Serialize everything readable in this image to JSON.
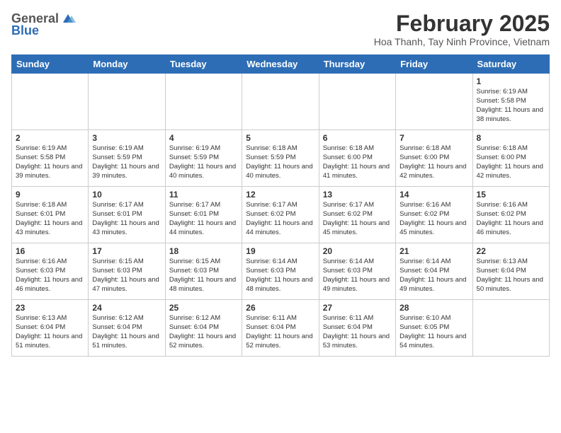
{
  "header": {
    "logo_general": "General",
    "logo_blue": "Blue",
    "month_title": "February 2025",
    "location": "Hoa Thanh, Tay Ninh Province, Vietnam"
  },
  "weekdays": [
    "Sunday",
    "Monday",
    "Tuesday",
    "Wednesday",
    "Thursday",
    "Friday",
    "Saturday"
  ],
  "weeks": [
    [
      {
        "day": "",
        "info": ""
      },
      {
        "day": "",
        "info": ""
      },
      {
        "day": "",
        "info": ""
      },
      {
        "day": "",
        "info": ""
      },
      {
        "day": "",
        "info": ""
      },
      {
        "day": "",
        "info": ""
      },
      {
        "day": "1",
        "info": "Sunrise: 6:19 AM\nSunset: 5:58 PM\nDaylight: 11 hours and 38 minutes."
      }
    ],
    [
      {
        "day": "2",
        "info": "Sunrise: 6:19 AM\nSunset: 5:58 PM\nDaylight: 11 hours and 39 minutes."
      },
      {
        "day": "3",
        "info": "Sunrise: 6:19 AM\nSunset: 5:59 PM\nDaylight: 11 hours and 39 minutes."
      },
      {
        "day": "4",
        "info": "Sunrise: 6:19 AM\nSunset: 5:59 PM\nDaylight: 11 hours and 40 minutes."
      },
      {
        "day": "5",
        "info": "Sunrise: 6:18 AM\nSunset: 5:59 PM\nDaylight: 11 hours and 40 minutes."
      },
      {
        "day": "6",
        "info": "Sunrise: 6:18 AM\nSunset: 6:00 PM\nDaylight: 11 hours and 41 minutes."
      },
      {
        "day": "7",
        "info": "Sunrise: 6:18 AM\nSunset: 6:00 PM\nDaylight: 11 hours and 42 minutes."
      },
      {
        "day": "8",
        "info": "Sunrise: 6:18 AM\nSunset: 6:00 PM\nDaylight: 11 hours and 42 minutes."
      }
    ],
    [
      {
        "day": "9",
        "info": "Sunrise: 6:18 AM\nSunset: 6:01 PM\nDaylight: 11 hours and 43 minutes."
      },
      {
        "day": "10",
        "info": "Sunrise: 6:17 AM\nSunset: 6:01 PM\nDaylight: 11 hours and 43 minutes."
      },
      {
        "day": "11",
        "info": "Sunrise: 6:17 AM\nSunset: 6:01 PM\nDaylight: 11 hours and 44 minutes."
      },
      {
        "day": "12",
        "info": "Sunrise: 6:17 AM\nSunset: 6:02 PM\nDaylight: 11 hours and 44 minutes."
      },
      {
        "day": "13",
        "info": "Sunrise: 6:17 AM\nSunset: 6:02 PM\nDaylight: 11 hours and 45 minutes."
      },
      {
        "day": "14",
        "info": "Sunrise: 6:16 AM\nSunset: 6:02 PM\nDaylight: 11 hours and 45 minutes."
      },
      {
        "day": "15",
        "info": "Sunrise: 6:16 AM\nSunset: 6:02 PM\nDaylight: 11 hours and 46 minutes."
      }
    ],
    [
      {
        "day": "16",
        "info": "Sunrise: 6:16 AM\nSunset: 6:03 PM\nDaylight: 11 hours and 46 minutes."
      },
      {
        "day": "17",
        "info": "Sunrise: 6:15 AM\nSunset: 6:03 PM\nDaylight: 11 hours and 47 minutes."
      },
      {
        "day": "18",
        "info": "Sunrise: 6:15 AM\nSunset: 6:03 PM\nDaylight: 11 hours and 48 minutes."
      },
      {
        "day": "19",
        "info": "Sunrise: 6:14 AM\nSunset: 6:03 PM\nDaylight: 11 hours and 48 minutes."
      },
      {
        "day": "20",
        "info": "Sunrise: 6:14 AM\nSunset: 6:03 PM\nDaylight: 11 hours and 49 minutes."
      },
      {
        "day": "21",
        "info": "Sunrise: 6:14 AM\nSunset: 6:04 PM\nDaylight: 11 hours and 49 minutes."
      },
      {
        "day": "22",
        "info": "Sunrise: 6:13 AM\nSunset: 6:04 PM\nDaylight: 11 hours and 50 minutes."
      }
    ],
    [
      {
        "day": "23",
        "info": "Sunrise: 6:13 AM\nSunset: 6:04 PM\nDaylight: 11 hours and 51 minutes."
      },
      {
        "day": "24",
        "info": "Sunrise: 6:12 AM\nSunset: 6:04 PM\nDaylight: 11 hours and 51 minutes."
      },
      {
        "day": "25",
        "info": "Sunrise: 6:12 AM\nSunset: 6:04 PM\nDaylight: 11 hours and 52 minutes."
      },
      {
        "day": "26",
        "info": "Sunrise: 6:11 AM\nSunset: 6:04 PM\nDaylight: 11 hours and 52 minutes."
      },
      {
        "day": "27",
        "info": "Sunrise: 6:11 AM\nSunset: 6:04 PM\nDaylight: 11 hours and 53 minutes."
      },
      {
        "day": "28",
        "info": "Sunrise: 6:10 AM\nSunset: 6:05 PM\nDaylight: 11 hours and 54 minutes."
      },
      {
        "day": "",
        "info": ""
      }
    ]
  ]
}
